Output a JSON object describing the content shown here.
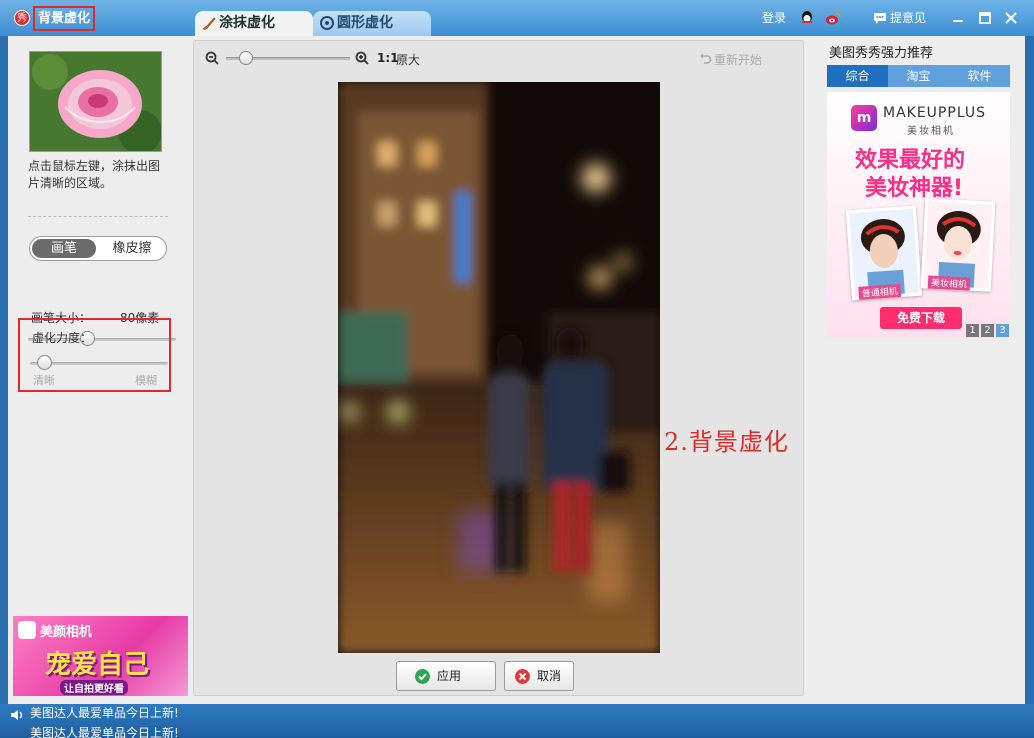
{
  "window": {
    "logo_char": "秀",
    "title": "背景虚化",
    "tabs": [
      {
        "label": "涂抹虚化",
        "active": true,
        "icon": "brush-icon"
      },
      {
        "label": "圆形虚化",
        "active": false,
        "icon": "circle-target-icon"
      }
    ],
    "login": "登录",
    "feedback": "提意见"
  },
  "left_panel": {
    "hint": "点击鼠标左键，涂抹出图片清晰的区域。",
    "mode_brush": "画笔",
    "mode_eraser": "橡皮擦",
    "brush_size_label": "画笔大小：",
    "brush_size_value": "80像素",
    "brush_size_fraction": 0.4,
    "blur_strength_label": "虚化力度：",
    "blur_min_label": "清晰",
    "blur_max_label": "模糊",
    "blur_strength_fraction": 0.1,
    "ad_title": "美颜相机",
    "ad_slogan": "宠爱自己",
    "ad_sub": "让自拍更好看"
  },
  "editor": {
    "zoom_ratio": "1:1",
    "zoom_original": "原大",
    "restart": "重新开始",
    "apply": "应用",
    "cancel": "取消"
  },
  "annotation": "2.背景虚化",
  "right_panel": {
    "title": "美图秀秀强力推荐",
    "tabs": [
      "综合",
      "淘宝",
      "软件"
    ],
    "ad_brand": "MAKEUPPLUS",
    "ad_brand_sub": "美妆相机",
    "ad_headline_1": "效果最好的",
    "ad_headline_2": "美妆神器!",
    "ad_cap_left": "普通相机",
    "ad_cap_right": "美妆相机",
    "ad_download": "免费下载",
    "pages": [
      "1",
      "2",
      "3"
    ],
    "active_page": "3"
  },
  "statusbar": {
    "news": [
      "美图达人最爱单品今日上新!",
      "美图达人最爱单品今日上新!"
    ]
  },
  "colors": {
    "accent": "#3d8fd2",
    "highlight": "#e02a2a",
    "title_bar": "#6fb2e6"
  }
}
